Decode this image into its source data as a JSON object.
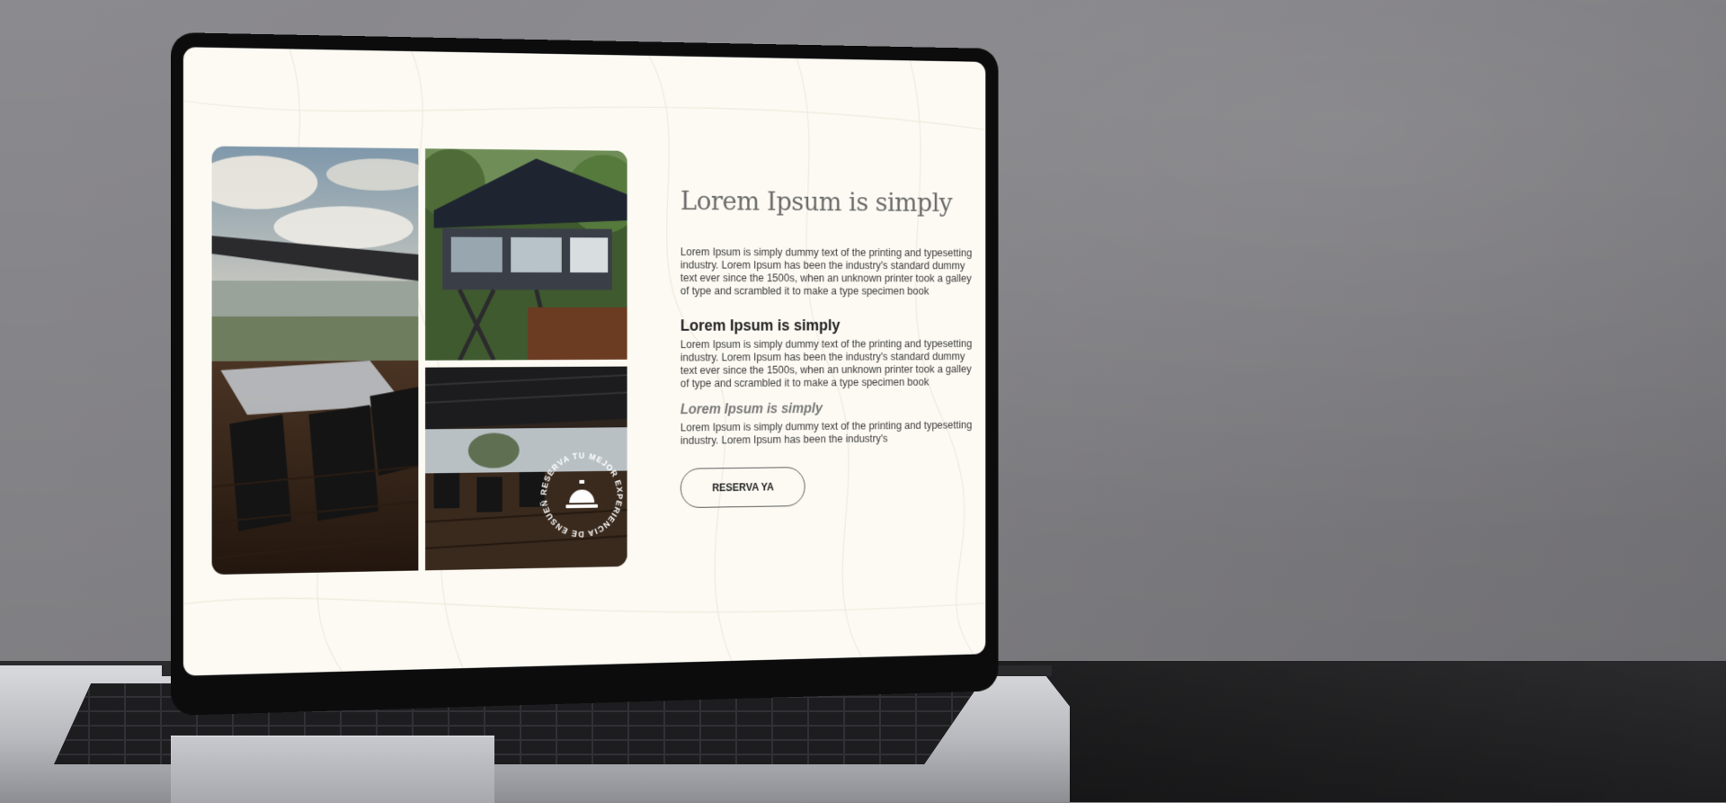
{
  "hero": {
    "title": "Lorem Ipsum is simply",
    "intro": "Lorem Ipsum is simply dummy text of the printing and typesetting industry. Lorem Ipsum has been the industry's standard dummy text ever since the 1500s, when an unknown printer took a galley of type and scrambled it to make a type specimen book",
    "section1": {
      "heading": "Lorem Ipsum is simply",
      "body": "Lorem Ipsum is simply dummy text of the printing and typesetting industry. Lorem Ipsum has been the industry's standard dummy text ever since the 1500s, when an unknown printer took a galley of type and scrambled it to make a type specimen book"
    },
    "section2": {
      "heading": "Lorem Ipsum is simply",
      "body": "Lorem Ipsum is simply dummy text of the printing and typesetting industry. Lorem Ipsum has been the industry's"
    },
    "cta_label": "RESERVA YA"
  },
  "badge": {
    "ring_text": "RESERVA TU MEJOR EXPERIENCIA DE ENSUEÑO",
    "icon": "service-bell-icon"
  },
  "gallery": {
    "images": [
      "terrace-umbrella-photo",
      "treehouse-restaurant-photo",
      "dining-deck-photo"
    ]
  },
  "colors": {
    "screen_bg": "#fcfaf3",
    "heading_serif": "#6b6b6b",
    "text": "#3a3a3a"
  }
}
